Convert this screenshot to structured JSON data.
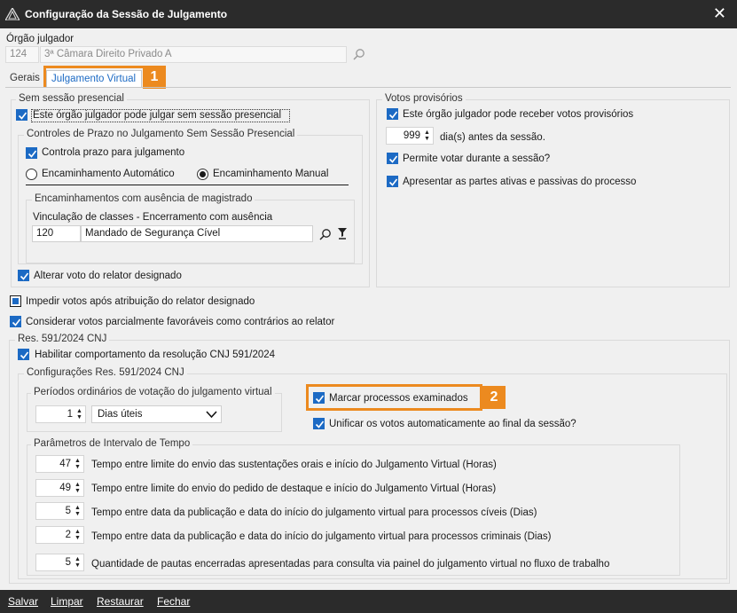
{
  "window": {
    "title": "Configuração da Sessão de Julgamento"
  },
  "orgao": {
    "label": "Órgão julgador",
    "code": "124",
    "name": "3ª Câmara Direito Privado A"
  },
  "tabs": {
    "gerais": "Gerais",
    "virtual": "Julgamento Virtual"
  },
  "badges": {
    "one": "1",
    "two": "2"
  },
  "sem_sessao": {
    "group_title": "Sem sessão presencial",
    "pode_julgar": "Este órgão julgador pode julgar sem sessão presencial",
    "controles_title": "Controles de Prazo no Julgamento Sem Sessão Presencial",
    "controla_prazo": "Controla prazo para julgamento",
    "enc_auto": "Encaminhamento Automático",
    "enc_manual": "Encaminhamento Manual",
    "ausencia_title": "Encaminhamentos com ausência de magistrado",
    "vinculacao_label": "Vinculação de classes - Encerramento com ausência",
    "vinc_code": "120",
    "vinc_name": "Mandado de Segurança Cível",
    "alterar_voto": "Alterar voto do relator designado"
  },
  "votos_provisorios": {
    "group_title": "Votos provisórios",
    "pode_receber": "Este órgão julgador pode receber votos provisórios",
    "dias_value": "999",
    "dias_label": "dia(s) antes da sessão.",
    "permite_votar": "Permite votar durante a sessão?",
    "apresentar_partes": "Apresentar as partes ativas e passivas do processo"
  },
  "impedir_votos": "Impedir votos após atribuição do relator designado",
  "considerar_votos": "Considerar votos parcialmente favoráveis como contrários ao relator",
  "res591": {
    "group_title": "Res. 591/2024 CNJ",
    "habilitar": "Habilitar comportamento da resolução CNJ 591/2024",
    "config_title": "Configurações Res. 591/2024 CNJ",
    "periodos_title": "Períodos ordinários de votação do julgamento virtual",
    "periodos_value": "1",
    "periodos_unit": "Dias úteis",
    "marcar": "Marcar processos examinados",
    "unificar": "Unificar os votos automaticamente ao final da sessão?",
    "parametros_title": "Parâmetros de Intervalo de Tempo",
    "params": [
      {
        "value": "47",
        "label": "Tempo entre limite do envio das sustentações orais e início do Julgamento Virtual (Horas)"
      },
      {
        "value": "49",
        "label": "Tempo entre limite do envio do pedido de destaque e início do Julgamento Virtual (Horas)"
      },
      {
        "value": "5",
        "label": "Tempo entre data da publicação e data do início do julgamento virtual para processos cíveis (Dias)"
      },
      {
        "value": "2",
        "label": "Tempo entre data da publicação e data do início do julgamento virtual para processos criminais (Dias)"
      },
      {
        "value": "5",
        "label": "Quantidade de pautas encerradas apresentadas para consulta via painel do julgamento virtual no fluxo de trabalho"
      }
    ]
  },
  "footer": {
    "salvar": "Salvar",
    "limpar": "Limpar",
    "restaurar": "Restaurar",
    "fechar": "Fechar"
  },
  "colors": {
    "accent": "#1c6ac4",
    "highlight": "#ec8a1f",
    "titlebar": "#2b2b2b"
  }
}
